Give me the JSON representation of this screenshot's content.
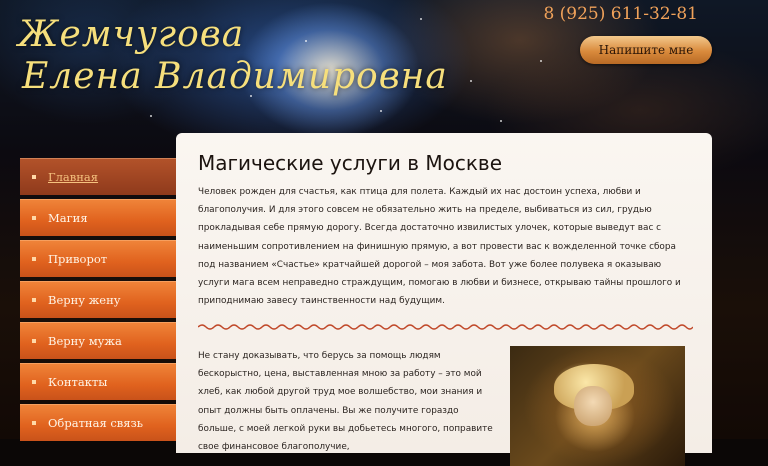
{
  "header": {
    "logo_line1": "Жемчугова",
    "logo_line2": "Елена Владимировна",
    "phone": "8 (925) 611-32-81",
    "cta_label": "Напишите мне"
  },
  "nav": {
    "items": [
      {
        "label": "Главная"
      },
      {
        "label": "Магия"
      },
      {
        "label": "Приворот"
      },
      {
        "label": "Верну жену"
      },
      {
        "label": "Верну мужа"
      },
      {
        "label": "Контакты"
      },
      {
        "label": "Обратная связь"
      }
    ]
  },
  "content": {
    "title": "Магические услуги в Москве",
    "intro": "Человек рожден для счастья, как птица для полета. Каждый их нас достоин успеха, любви и благополучия. И для этого совсем не обязательно жить на пределе, выбиваться из сил, грудью прокладывая себе прямую дорогу. Всегда достаточно извилистых улочек, которые выведут вас с наименьшим сопротивлением на финишную прямую, а вот провести вас к вожделенной точке сбора под названием «Счастье» кратчайшей дорогой – моя забота. Вот уже более полувека я оказываю услуги мага всем неправедно страждущим, помогаю в любви и бизнесе, открываю тайны прошлого и приподнимаю завесу таинственности над будущим.",
    "second": "Не стану доказывать, что берусь за помощь людям бескорыстно, цена, выставленная мною за работу – это мой хлеб, как любой другой труд мое волшебство, мои знания и опыт должны быть оплачены. Вы же получите гораздо больше, с моей легкой руки вы добьетесь многого, поправите свое финансовое благополучие,"
  },
  "colors": {
    "logo": "#f6df7c",
    "phone": "#f0a25a",
    "nav_orange": "#e0621e",
    "nav_active": "#8f3a1c",
    "panel_bg": "#faf6f1",
    "wave": "#c0492a"
  }
}
